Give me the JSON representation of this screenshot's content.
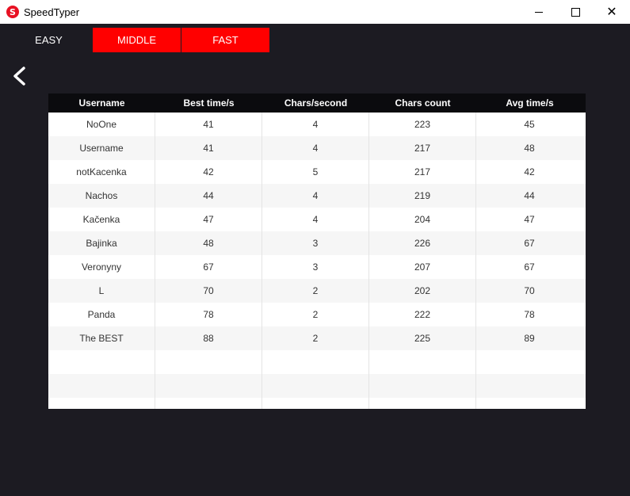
{
  "window": {
    "title": "SpeedTyper",
    "icon_letter": "S"
  },
  "tabs": [
    {
      "label": "EASY"
    },
    {
      "label": "MIDDLE"
    },
    {
      "label": "FAST"
    }
  ],
  "colors": {
    "accent": "#ff0000",
    "background": "#1c1b22",
    "header": "#0b0b0e"
  },
  "table": {
    "headers": [
      "Username",
      "Best time/s",
      "Chars/second",
      "Chars count",
      "Avg time/s"
    ],
    "rows": [
      [
        "NoOne",
        "41",
        "4",
        "223",
        "45"
      ],
      [
        "Username",
        "41",
        "4",
        "217",
        "48"
      ],
      [
        "notKacenka",
        "42",
        "5",
        "217",
        "42"
      ],
      [
        "Nachos",
        "44",
        "4",
        "219",
        "44"
      ],
      [
        "Kačenka",
        "47",
        "4",
        "204",
        "47"
      ],
      [
        "Bajinka",
        "48",
        "3",
        "226",
        "67"
      ],
      [
        "Veronyny",
        "67",
        "3",
        "207",
        "67"
      ],
      [
        "L",
        "70",
        "2",
        "202",
        "70"
      ],
      [
        "Panda",
        "78",
        "2",
        "222",
        "78"
      ],
      [
        "The BEST",
        "88",
        "2",
        "225",
        "89"
      ]
    ]
  }
}
